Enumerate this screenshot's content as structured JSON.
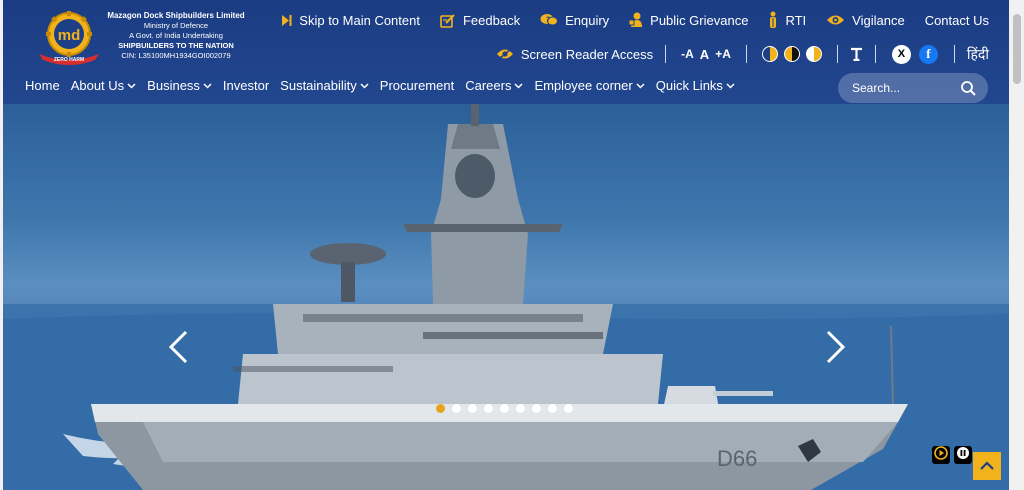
{
  "org": {
    "name": "Mazagon Dock Shipbuilders Limited",
    "ministry": "Ministry of Defence",
    "undertaking": "A Govt. of India Undertaking",
    "tagline": "SHIPBUILDERS TO THE NATION",
    "cin": "CIN: L35100MH1934GOI002079",
    "logo_text": "md",
    "logo_banner": "ZERO HARM"
  },
  "toplinks": [
    {
      "label": "Skip to Main Content",
      "icon": "skip-icon"
    },
    {
      "label": "Feedback",
      "icon": "feedback-icon"
    },
    {
      "label": "Enquiry",
      "icon": "enquiry-icon"
    },
    {
      "label": "Public Grievance",
      "icon": "grievance-icon"
    },
    {
      "label": "RTI",
      "icon": "rti-icon"
    },
    {
      "label": "Vigilance",
      "icon": "vigilance-icon"
    },
    {
      "label": "Contact Us",
      "icon": ""
    }
  ],
  "accessibility": {
    "screen_reader": "Screen Reader Access",
    "font_decrease": "-A",
    "font_normal": "A",
    "font_increase": "+A",
    "hindi": "हिंदी",
    "x_label": "X",
    "fb_label": "f"
  },
  "nav": [
    {
      "label": "Home",
      "dropdown": false
    },
    {
      "label": "About Us",
      "dropdown": true
    },
    {
      "label": "Business",
      "dropdown": true
    },
    {
      "label": "Investor",
      "dropdown": false
    },
    {
      "label": "Sustainability",
      "dropdown": true
    },
    {
      "label": "Procurement",
      "dropdown": false
    },
    {
      "label": "Careers",
      "dropdown": true
    },
    {
      "label": "Employee corner",
      "dropdown": true
    },
    {
      "label": "Quick Links",
      "dropdown": true
    }
  ],
  "search": {
    "placeholder": "Search..."
  },
  "hero": {
    "hull_number": "D66",
    "slide_count": 9,
    "active_slide": 1
  },
  "colors": {
    "header": "#1d3f85",
    "accent": "#e8a21b",
    "gold": "#f2b21c"
  }
}
